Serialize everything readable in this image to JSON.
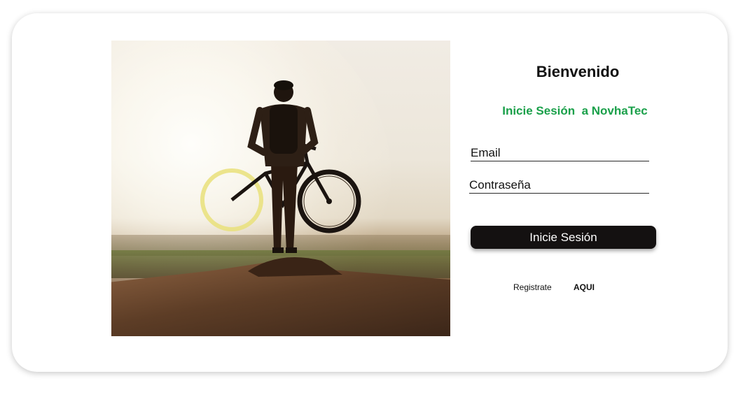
{
  "login": {
    "title": "Bienvenido",
    "subtitle": "Inicie Sesión  a NovhaTec",
    "email_placeholder": "Email",
    "email_value": "",
    "password_placeholder": "Contraseña",
    "password_value": "",
    "submit_label": "Inicie Sesión",
    "register_text": "Registrate",
    "register_link": "AQUI"
  },
  "hero": {
    "icon": "cyclist-photo"
  },
  "colors": {
    "accent_green": "#1aa04a",
    "button_dark": "#141111",
    "background": "#ffffff"
  }
}
